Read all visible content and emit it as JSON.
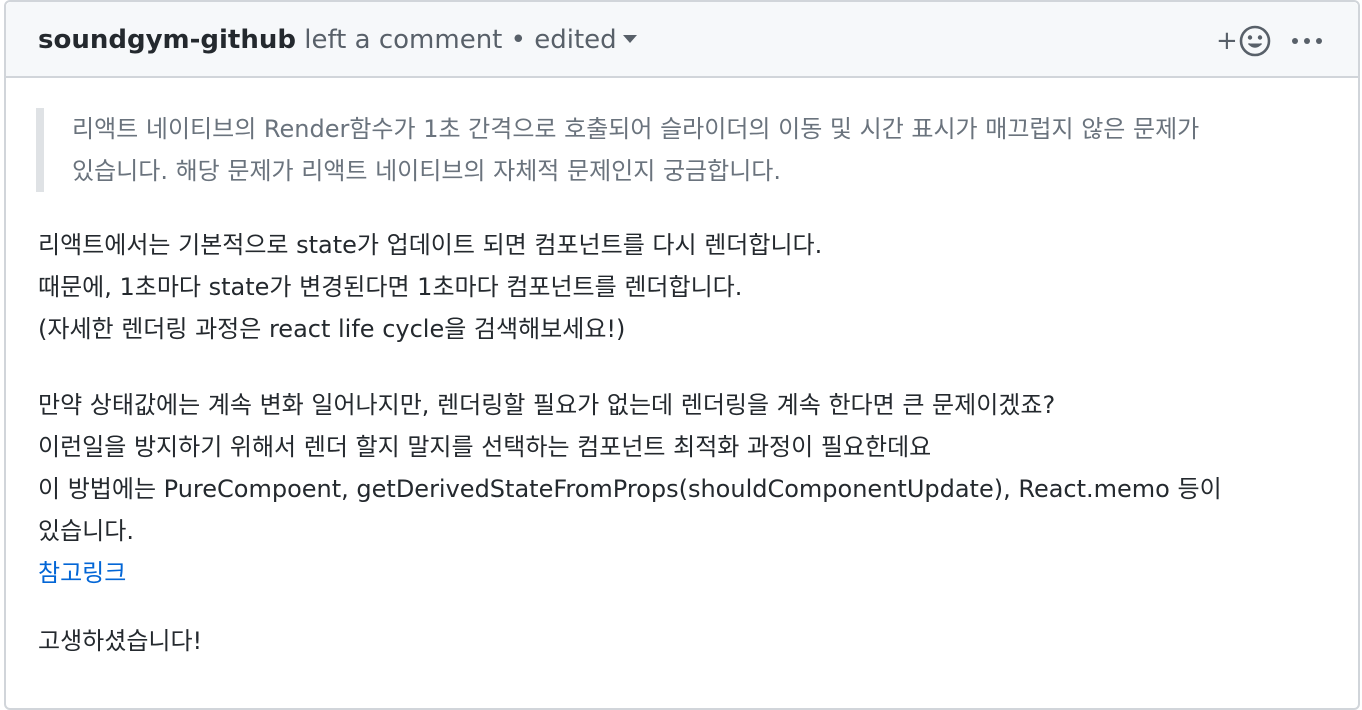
{
  "header": {
    "author": "soundgym-github",
    "action": "left a comment",
    "separator": "•",
    "edited_label": "edited",
    "reaction_plus": "+",
    "reaction_icon": "smiley-icon",
    "more_icon": "kebab-horizontal-icon"
  },
  "body": {
    "quote_lines": [
      "리액트 네이티브의 Render함수가 1초 간격으로 호출되어 슬라이더의 이동 및 시간 표시가 매끄럽지 않은 문제가",
      "있습니다. 해당 문제가 리액트 네이티브의 자체적 문제인지 궁금합니다."
    ],
    "para1": [
      "리액트에서는 기본적으로 state가 업데이트 되면 컴포넌트를 다시 렌더합니다.",
      "때문에, 1초마다 state가 변경된다면 1초마다 컴포넌트를 렌더합니다.",
      "(자세한 렌더링 과정은 react life cycle을 검색해보세요!)"
    ],
    "para2": [
      "만약 상태값에는 계속 변화 일어나지만, 렌더링할 필요가 없는데 렌더링을 계속 한다면 큰 문제이겠죠?",
      "이런일을 방지하기 위해서 렌더 할지 말지를 선택하는 컴포넌트 최적화 과정이 필요한데요",
      "이 방법에는 PureCompoent, getDerivedStateFromProps(shouldComponentUpdate), React.memo 등이",
      "있습니다."
    ],
    "reference_link": "참고링크",
    "closing": "고생하셨습니다!"
  },
  "colors": {
    "link": "#0366d6",
    "header_bg": "#f6f8fa",
    "border": "#d1d5da",
    "quote_text": "#6a737d",
    "quote_bar": "#dfe2e5"
  }
}
